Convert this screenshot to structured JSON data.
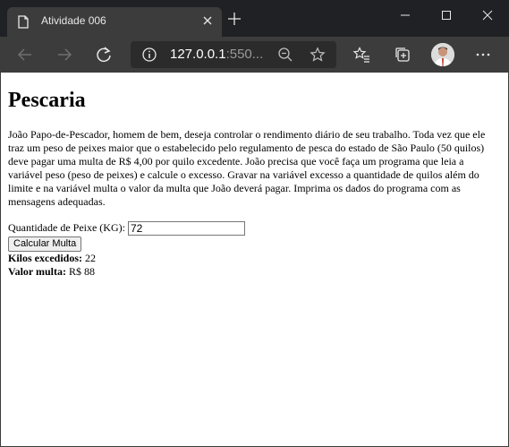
{
  "browser": {
    "tab_title": "Atividade 006",
    "url_main": "127.0.0.1",
    "url_dim": ":550..."
  },
  "page": {
    "heading": "Pescaria",
    "description": "João Papo-de-Pescador, homem de bem, deseja controlar o rendimento diário de seu trabalho. Toda vez que ele traz um peso de peixes maior que o estabelecido pelo regulamento de pesca do estado de São Paulo (50 quilos) deve pagar uma multa de R$ 4,00 por quilo excedente. João precisa que você faça um programa que leia a variável peso (peso de peixes) e calcule o excesso. Gravar na variável excesso a quantidade de quilos além do limite e na variável multa o valor da multa que João deverá pagar. Imprima os dados do programa com as mensagens adequadas.",
    "input_label": "Quantidade de Peixe (KG):",
    "input_value": "72",
    "button_label": "Calcular Multa",
    "excess_label": "Kilos excedidos:",
    "excess_value": "22",
    "fine_label": "Valor multa:",
    "fine_value": "R$ 88"
  }
}
